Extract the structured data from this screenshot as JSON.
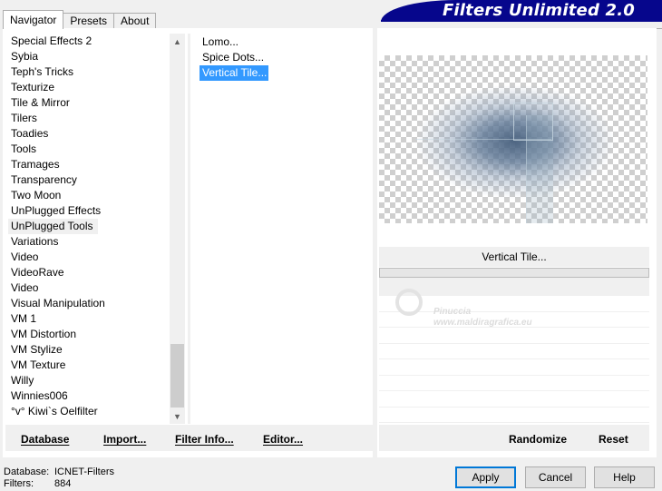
{
  "tabs": [
    {
      "label": "Navigator"
    },
    {
      "label": "Presets"
    },
    {
      "label": "About"
    }
  ],
  "banner": {
    "title": "Filters Unlimited 2.0",
    "color": "#06068c"
  },
  "categories": {
    "items": [
      "Special Effects 2",
      "Sybia",
      "Teph's Tricks",
      "Texturize",
      "Tile & Mirror",
      "Tilers",
      "Toadies",
      "Tools",
      "Tramages",
      "Transparency",
      "Two Moon",
      "UnPlugged Effects",
      "UnPlugged Tools",
      "Variations",
      "Video",
      "VideoRave",
      "Video",
      "Visual Manipulation",
      "VM 1",
      "VM Distortion",
      "VM Stylize",
      "VM Texture",
      "Willy",
      "Winnies006",
      "°v° Kiwi`s Oelfilter"
    ],
    "selected": "UnPlugged Tools"
  },
  "filters": {
    "items": [
      "Lomo...",
      "Spice Dots...",
      "Vertical Tile..."
    ],
    "selected": "Vertical Tile...",
    "selected_color": "#3399ff"
  },
  "preview": {
    "filter_name": "Vertical Tile..."
  },
  "watermark": {
    "line1": "Pinuccia",
    "line2": "www.maldiragrafica.eu"
  },
  "toolbar": {
    "database": "Database",
    "import": "Import...",
    "filter_info": "Filter Info...",
    "editor": "Editor...",
    "randomize": "Randomize",
    "reset": "Reset"
  },
  "status": {
    "database_label": "Database:",
    "database_value": "ICNET-Filters",
    "filters_label": "Filters:",
    "filters_value": "884"
  },
  "buttons": {
    "apply": "Apply",
    "cancel": "Cancel",
    "help": "Help"
  },
  "icons": {
    "scroll_up": "chevron-up-icon",
    "scroll_down": "chevron-down-icon"
  }
}
